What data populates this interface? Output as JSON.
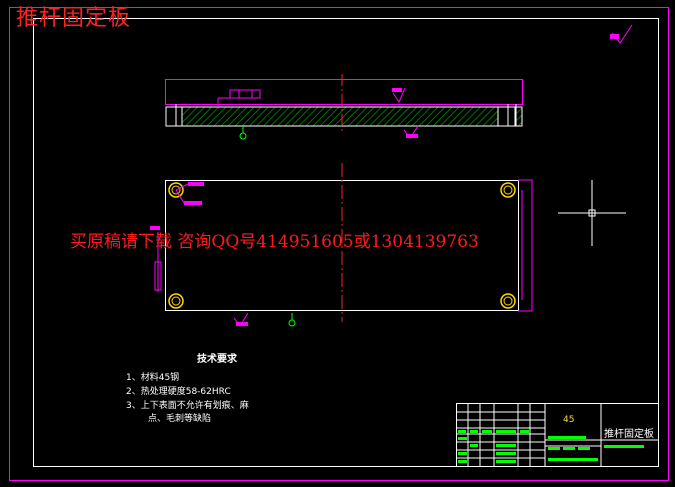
{
  "drawing": {
    "title": "推杆固定板",
    "watermark": "买原稿请下载  咨询QQ号414951605或1304139763",
    "tech_heading": "技术要求",
    "requirements": [
      "1、材料45钢",
      "2、热处理硬度58-62HRC",
      "3、上下表面不允许有划痕、麻",
      "点、毛刺等缺陷"
    ],
    "title_block": {
      "material": "45",
      "part_name": "推杆固定板"
    },
    "corner_roughness": "6.3",
    "colors": {
      "background": "#000000",
      "frame": "#ff00ff",
      "outline": "#ffffff",
      "centerline": "#ff2020",
      "hatch": "#00c800",
      "dimension": "#ff00ff",
      "annotation": "#00ff00",
      "hole": "#ffd700",
      "title_text": "#ff2020"
    }
  }
}
